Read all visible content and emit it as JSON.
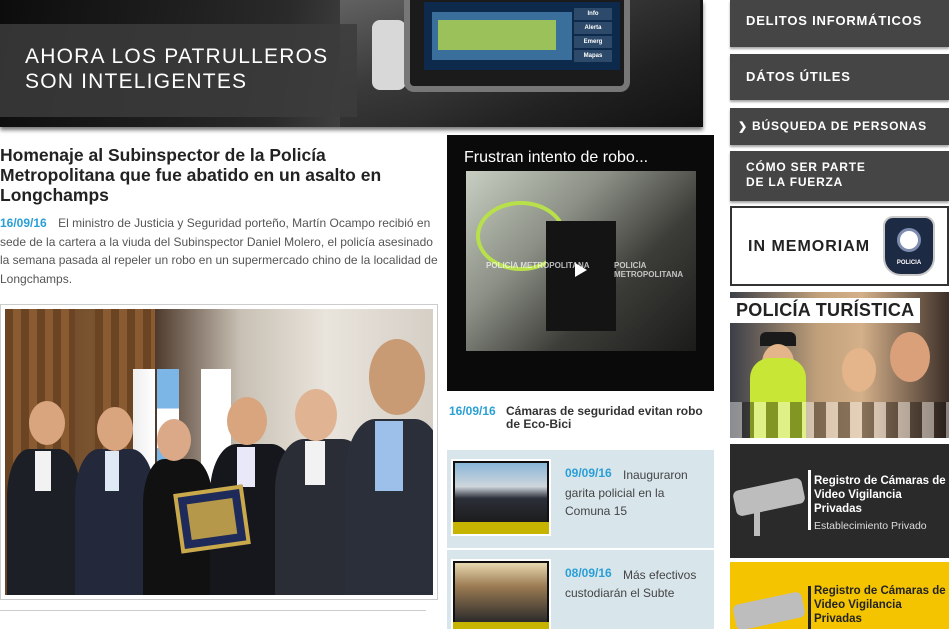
{
  "banner": {
    "title_line1": "AHORA LOS PATRULLEROS",
    "title_line2": "SON INTELIGENTES",
    "screen_buttons": [
      "Info",
      "Alerta",
      "Emerg",
      "Mapas"
    ]
  },
  "article": {
    "title": "Homenaje al Subinspector de la Policía Metropolitana que fue abatido en un asalto en Longchamps",
    "date": "16/09/16",
    "summary": "El ministro de Justicia y Seguridad porteño, Martín Ocampo recibió en sede de la cartera a la viuda del Subinspector Daniel Molero, el policía asesinado la semana pasada al repeler un robo en un supermercado chino de la localidad de Longchamps."
  },
  "video": {
    "title": "Frustran intento de robo...",
    "watermark": "POLICÍA METROPOLITANA"
  },
  "side_news": {
    "date": "16/09/16",
    "text": "Cámaras de seguridad evitan robo de Eco-Bici"
  },
  "mini_news": [
    {
      "date": "09/09/16",
      "text": "Inauguraron garita policial en la Comuna 15"
    },
    {
      "date": "08/09/16",
      "text": "Más efectivos custodiarán el Subte"
    }
  ],
  "sidebar": {
    "items": [
      {
        "label": "DELITOS INFORMÁTICOS"
      },
      {
        "label": "DÁTOS ÚTILES"
      },
      {
        "label": "BÚSQUEDA DE PERSONAS",
        "arrow": "❯"
      },
      {
        "label_line1": "CÓMO SER PARTE",
        "label_line2": "DE LA FUERZA"
      }
    ],
    "memoriam": "IN MEMORIAM",
    "shield_text": "POLICIA",
    "turistica": "POLICÍA TURÍSTICA",
    "registro_privado": {
      "title": "Registro de Cámaras de Video Vigilancia Privadas",
      "subtitle": "Establecimiento Privado"
    },
    "registro_publico": {
      "title": "Registro de Cámaras de Video Vigilancia Privadas"
    }
  },
  "colors": {
    "date_blue": "#2a9fd6",
    "sidebar_dark": "#454545",
    "registro_yellow": "#f5c400",
    "mini_bg": "#d8e6ec"
  }
}
